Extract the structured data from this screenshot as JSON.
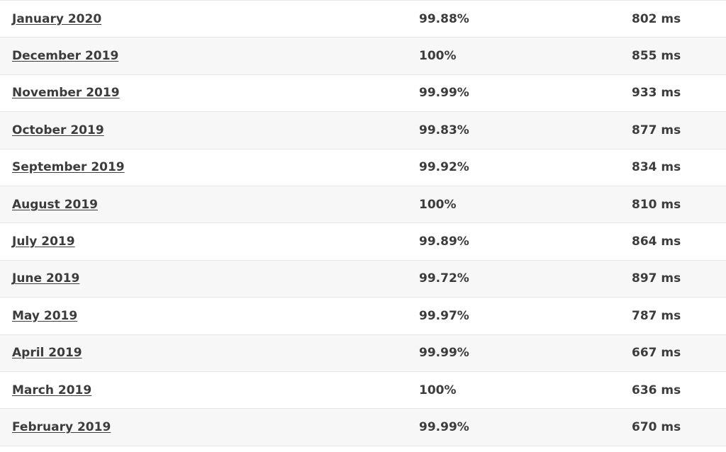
{
  "rows": [
    {
      "month": "January 2020",
      "uptime": "99.88%",
      "response_time": "802 ms"
    },
    {
      "month": "December 2019",
      "uptime": "100%",
      "response_time": "855 ms"
    },
    {
      "month": "November 2019",
      "uptime": "99.99%",
      "response_time": "933 ms"
    },
    {
      "month": "October 2019",
      "uptime": "99.83%",
      "response_time": "877 ms"
    },
    {
      "month": "September 2019",
      "uptime": "99.92%",
      "response_time": "834 ms"
    },
    {
      "month": "August 2019",
      "uptime": "100%",
      "response_time": "810 ms"
    },
    {
      "month": "July 2019",
      "uptime": "99.89%",
      "response_time": "864 ms"
    },
    {
      "month": "June 2019",
      "uptime": "99.72%",
      "response_time": "897 ms"
    },
    {
      "month": "May 2019",
      "uptime": "99.97%",
      "response_time": "787 ms"
    },
    {
      "month": "April 2019",
      "uptime": "99.99%",
      "response_time": "667 ms"
    },
    {
      "month": "March 2019",
      "uptime": "100%",
      "response_time": "636 ms"
    },
    {
      "month": "February 2019",
      "uptime": "99.99%",
      "response_time": "670 ms"
    }
  ],
  "colors": {
    "text": "#3c3c3c",
    "row_alt": "#f7f7f7",
    "row": "#ffffff",
    "border": "#e6e6e6"
  }
}
